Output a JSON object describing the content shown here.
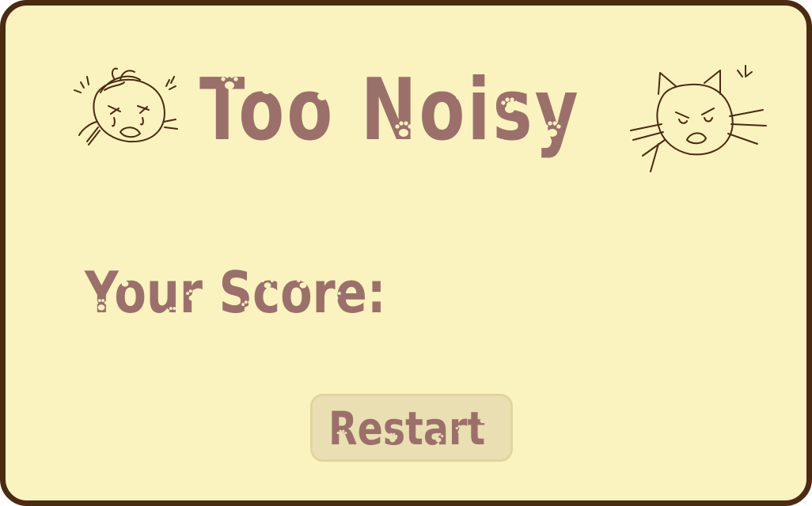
{
  "game": {
    "title": "Too Noisy",
    "score_label": "Your Score:",
    "score_value": "",
    "restart_label": "Restart"
  },
  "colors": {
    "background": "#faf3bf",
    "border": "#4a2a10",
    "text": "#9b706b",
    "button_bg": "#eadfb2"
  },
  "icons": {
    "left_doodle": "angry-person-doodle-icon",
    "right_doodle": "angry-cat-doodle-icon",
    "decoration": "paw-print-icon"
  }
}
